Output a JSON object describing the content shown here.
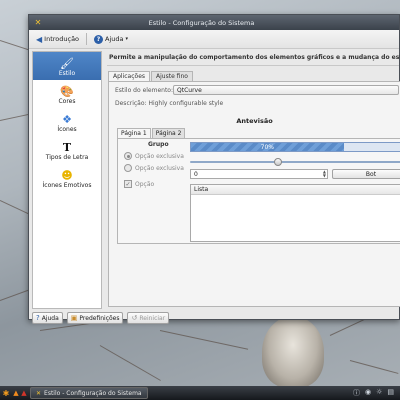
{
  "window": {
    "title": "Estilo - Configuração do Sistema"
  },
  "toolbar": {
    "overview_label": "Introdução",
    "help_label": "Ajuda"
  },
  "sidebar": {
    "items": [
      {
        "label": "Estilo",
        "icon": "style-brush-icon",
        "selected": true
      },
      {
        "label": "Cores",
        "icon": "color-palette-icon",
        "selected": false
      },
      {
        "label": "Ícones",
        "icon": "icons-icon",
        "selected": false
      },
      {
        "label": "Tipos de Letra",
        "icon": "font-icon",
        "selected": false
      },
      {
        "label": "Ícones Emotivos",
        "icon": "smiley-icon",
        "selected": false
      }
    ]
  },
  "content": {
    "description": "Permite a manipulação do comportamento dos elementos gráficos e a mudança do estilo pa",
    "tabs": [
      "Aplicações",
      "Ajuste fino"
    ],
    "widget_style_label": "Estilo do elemento:",
    "widget_style_value": "QtCurve",
    "style_description": "Descrição: Highly configurable style",
    "preview_title": "Antevisão",
    "preview_tabs": [
      "Página 1",
      "Página 2"
    ],
    "group_title": "Grupo",
    "radio1_label": "Opção exclusiva",
    "radio2_label": "Opção exclusiva",
    "checkbox_label": "Opção",
    "progress_text": "70%",
    "progress_value": 0.7,
    "slider_value": 0.4,
    "spin_value": "0",
    "button_label": "Bot",
    "list_header": "Lista"
  },
  "bottom": {
    "help_label": "Ajuda",
    "defaults_label": "Predefinições",
    "reset_label": "Reiniciar"
  },
  "taskbar": {
    "task_label": "Estilo - Configuração do Sistema"
  }
}
